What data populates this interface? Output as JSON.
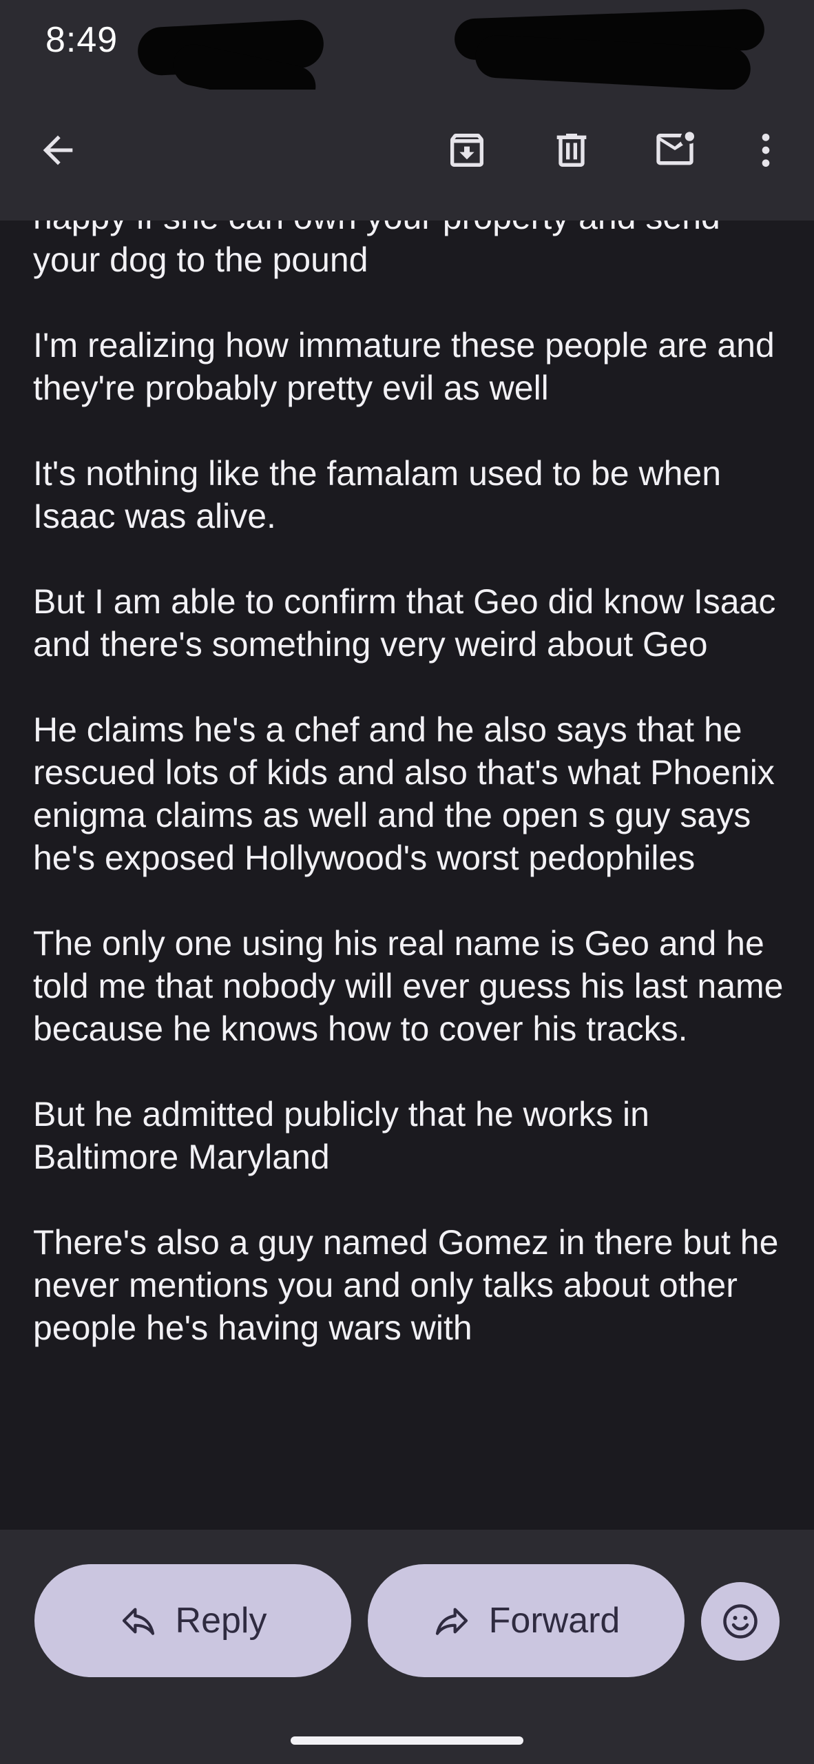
{
  "status_bar": {
    "time": "8:49"
  },
  "app_bar": {
    "icons": [
      "back-arrow-icon",
      "archive-icon",
      "delete-icon",
      "mark-unread-icon",
      "more-vert-icon"
    ]
  },
  "message": {
    "paragraphs": [
      "happy if she can own your property and send your dog to the pound",
      "I'm realizing how immature these people are and they're probably pretty evil as well",
      "It's nothing like the famalam used to be when Isaac was alive.",
      "But I am able to confirm that Geo did know Isaac and there's something very weird about Geo",
      "He claims he's a chef and he also says that he rescued lots of kids and also that's what Phoenix enigma claims as well and the open s guy says he's exposed Hollywood's worst pedophiles",
      "The only one using his real name is Geo and he told me that nobody will ever guess his last name because he knows how to cover his tracks.",
      "But he admitted publicly that he works in Baltimore Maryland",
      "There's also a guy named Gomez in there but he never mentions you and only talks about other people he's having wars with"
    ]
  },
  "actions": {
    "reply_label": "Reply",
    "forward_label": "Forward",
    "emoji_icon": "emoji-smile-icon"
  },
  "colors": {
    "background": "#1b1a1f",
    "bar": "#2c2b31",
    "pill": "#cbc6e0",
    "pill_text": "#2f2b40"
  }
}
